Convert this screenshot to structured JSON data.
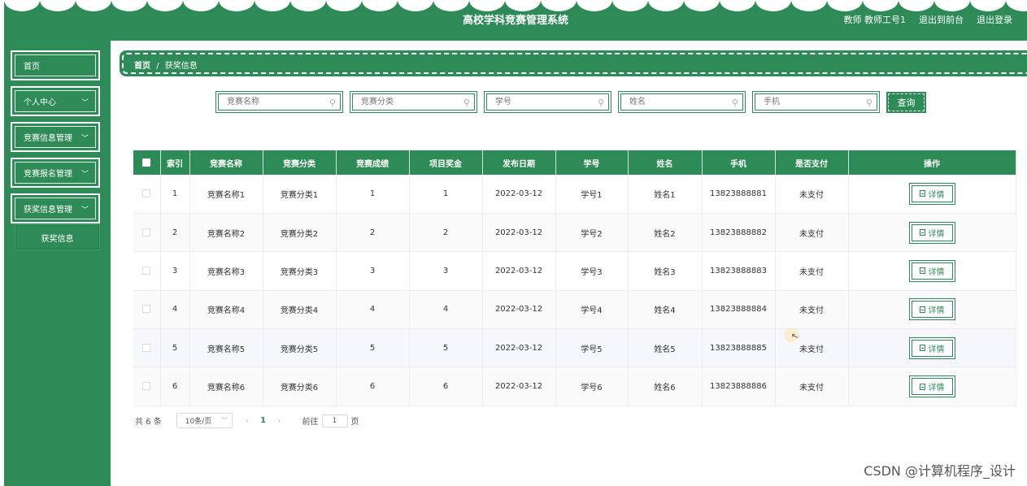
{
  "header": {
    "title": "高校学科竞赛管理系统",
    "user_label": "教师 教师工号1",
    "front_link": "退出到前台",
    "logout_link": "退出登录"
  },
  "sidebar": {
    "items": [
      {
        "label": "首页",
        "expandable": false
      },
      {
        "label": "个人中心",
        "expandable": true
      },
      {
        "label": "竞赛信息管理",
        "expandable": true
      },
      {
        "label": "竞赛报名管理",
        "expandable": true
      },
      {
        "label": "获奖信息管理",
        "expandable": true
      }
    ],
    "sub_item": "获奖信息"
  },
  "breadcrumb": {
    "home": "首页",
    "separator": "/",
    "current": "获奖信息"
  },
  "search": {
    "fields": [
      {
        "placeholder": "竞赛名称"
      },
      {
        "placeholder": "竞赛分类"
      },
      {
        "placeholder": "学号"
      },
      {
        "placeholder": "姓名"
      },
      {
        "placeholder": "手机"
      }
    ],
    "button": "查询"
  },
  "table": {
    "columns": [
      "索引",
      "竞赛名称",
      "竞赛分类",
      "竞赛成绩",
      "项目奖金",
      "发布日期",
      "学号",
      "姓名",
      "手机",
      "是否支付",
      "操作"
    ],
    "rows": [
      [
        "1",
        "竞赛名称1",
        "竞赛分类1",
        "1",
        "1",
        "2022-03-12",
        "学号1",
        "姓名1",
        "13823888881",
        "未支付"
      ],
      [
        "2",
        "竞赛名称2",
        "竞赛分类2",
        "2",
        "2",
        "2022-03-12",
        "学号2",
        "姓名2",
        "13823888882",
        "未支付"
      ],
      [
        "3",
        "竞赛名称3",
        "竞赛分类3",
        "3",
        "3",
        "2022-03-12",
        "学号3",
        "姓名3",
        "13823888883",
        "未支付"
      ],
      [
        "4",
        "竞赛名称4",
        "竞赛分类4",
        "4",
        "4",
        "2022-03-12",
        "学号4",
        "姓名4",
        "13823888884",
        "未支付"
      ],
      [
        "5",
        "竞赛名称5",
        "竞赛分类5",
        "5",
        "5",
        "2022-03-12",
        "学号5",
        "姓名5",
        "13823888885",
        "未支付"
      ],
      [
        "6",
        "竞赛名称6",
        "竞赛分类6",
        "6",
        "6",
        "2022-03-12",
        "学号6",
        "姓名6",
        "13823888886",
        "未支付"
      ]
    ],
    "action_label": "详情"
  },
  "pagination": {
    "total": "共 6 条",
    "page_size": "10条/页",
    "current_page": "1",
    "goto_prefix": "前往",
    "goto_value": "1",
    "goto_suffix": "页"
  },
  "watermark": "CSDN @计算机程序_设计",
  "colors": {
    "primary": "#2e8b57",
    "white": "#ffffff"
  }
}
